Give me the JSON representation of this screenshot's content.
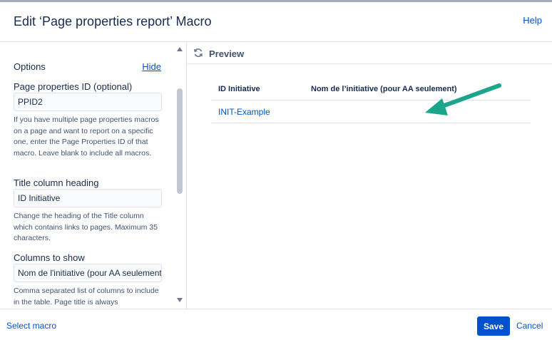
{
  "dialog": {
    "title": "Edit ‘Page properties report’ Macro",
    "help_label": "Help"
  },
  "sidebar": {
    "options_label": "Options",
    "hide_label": "Hide",
    "fields": [
      {
        "label": "Page properties ID (optional)",
        "value": "PPID2",
        "help": "If you have multiple page properties macros on a page and want to report on a specific one, enter the Page Properties ID of that macro. Leave blank to include all macros."
      },
      {
        "label": "Title column heading",
        "value": "ID Initiative",
        "help": "Change the heading of the Title column which contains links to pages. Maximum 35 characters."
      },
      {
        "label": "Columns to show",
        "value": "Nom de l'initiative (pour AA seulement)",
        "help": "Comma separated list of columns to include in the table. Page title is always"
      }
    ]
  },
  "preview": {
    "title": "Preview",
    "columns": [
      "ID Initiative",
      "Nom de l’initiative (pour AA seulement)"
    ],
    "rows": [
      {
        "link": "INIT-Example"
      }
    ]
  },
  "footer": {
    "select_macro_label": "Select macro",
    "save_label": "Save",
    "cancel_label": "Cancel"
  },
  "colors": {
    "primary": "#0052cc",
    "text": "#172b4d",
    "border": "#dfe1e6",
    "arrow": "#1aa68a"
  },
  "icons": {
    "preview": "refresh-icon",
    "annotation": "arrow-icon"
  }
}
